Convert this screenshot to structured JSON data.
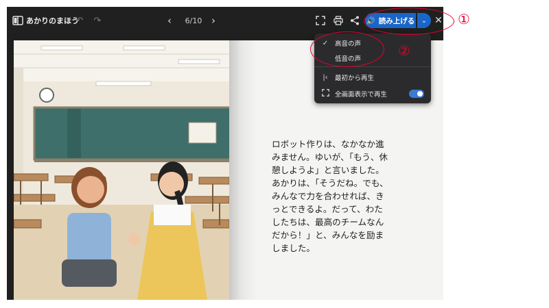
{
  "toolbar": {
    "title": "あかりのまほう",
    "page_indicator": "6/10",
    "read_aloud_label": "読み上げる"
  },
  "voice_menu": {
    "items": [
      {
        "label": "高音の声",
        "checked": true
      },
      {
        "label": "低音の声",
        "checked": false
      }
    ],
    "play_from_start_label": "最初から再生",
    "fullscreen_play_label": "全画面表示で再生",
    "fullscreen_play_enabled": true
  },
  "story_text": "ロボット作りは、なかなか進\nみません。ゆいが、「もう、休\n憩しようよ」と言いました。\nあかりは、「そうだね。でも、\nみんなで力を合わせれば、き\nっとできるよ。だって、わた\nしたちは、最高のチームなん\nだから！」と、みんなを励ま\nしました。",
  "annotations": {
    "marker_1": "①",
    "marker_2": "②"
  },
  "colors": {
    "accent": "#1a66c8",
    "annotation": "#e3002b",
    "toolbar_bg": "#202020"
  }
}
